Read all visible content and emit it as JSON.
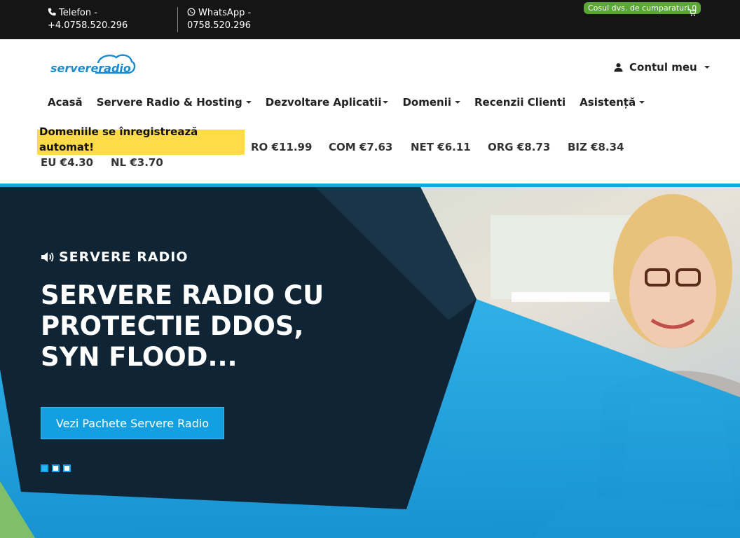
{
  "topbar": {
    "phone_label": "Telefon -",
    "phone_number": "+4.0758.520.296",
    "whatsapp_label": "WhatsApp -",
    "whatsapp_number": "0758.520.296",
    "cart_text": "Cosul dvs. de cumparaturi 0",
    "icons": [
      "phone-icon",
      "whatsapp-icon",
      "cart-icon"
    ]
  },
  "header": {
    "logo_text": "servereradio",
    "account_label": "Contul meu"
  },
  "nav": {
    "items": [
      {
        "label": "Acasă",
        "dropdown": false
      },
      {
        "label": "Servere Radio & Hosting",
        "dropdown": true
      },
      {
        "label": "Dezvoltare Aplicatii",
        "dropdown": true
      },
      {
        "label": "Domenii",
        "dropdown": true
      },
      {
        "label": "Recenzii Clienti",
        "dropdown": false
      },
      {
        "label": "Asistență",
        "dropdown": true
      }
    ]
  },
  "domains": {
    "promo": "Domeniile se înregistrează automat!",
    "prices": [
      {
        "label": "RO €11.99"
      },
      {
        "label": "COM €7.63"
      },
      {
        "label": "NET €6.11"
      },
      {
        "label": "ORG €8.73"
      },
      {
        "label": "BIZ €8.34"
      },
      {
        "label": "EU €4.30"
      },
      {
        "label": "NL €3.70"
      }
    ]
  },
  "hero": {
    "eyebrow": "SERVERE RADIO",
    "title": "SERVERE RADIO CU PROTECTIE DDOS, SYN FLOOD...",
    "button_label": "Vezi Pachete Servere Radio",
    "slide_count": 3,
    "active_slide": 1,
    "colors": {
      "dark_panel": "#0f2536",
      "accent": "#12a0e3",
      "promo": "#ffdb4a"
    }
  }
}
